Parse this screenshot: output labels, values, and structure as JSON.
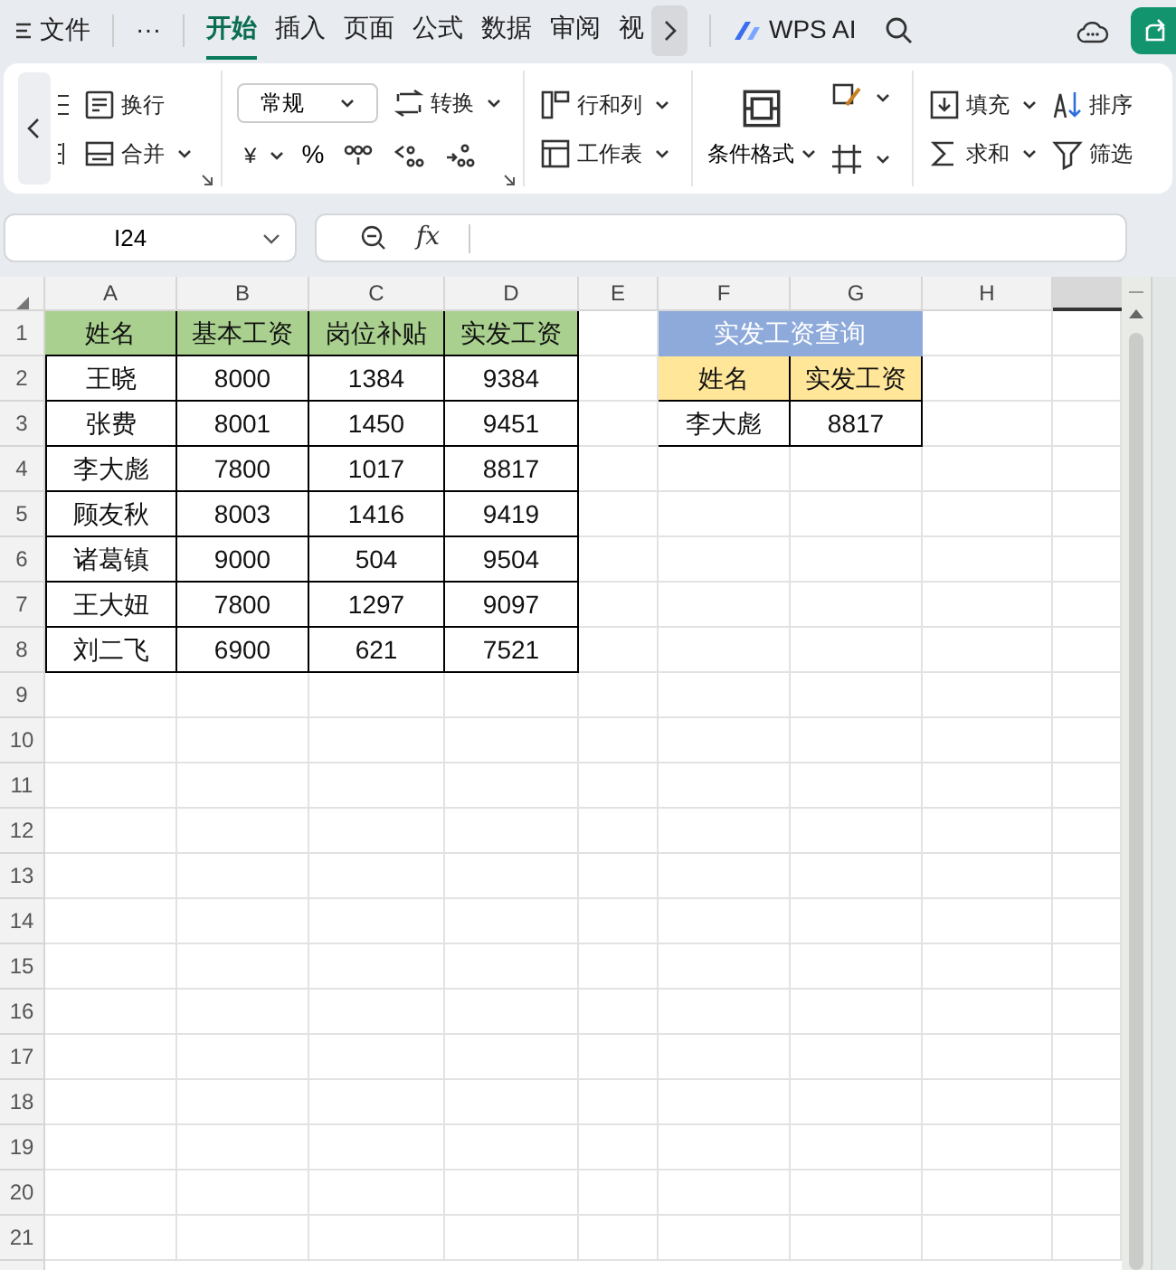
{
  "top_bar": {
    "file_menu": "文件",
    "more": "···",
    "ai_button": "WPS AI"
  },
  "tabs": [
    {
      "label": "开始",
      "selected": true
    },
    {
      "label": "插入",
      "selected": false
    },
    {
      "label": "页面",
      "selected": false
    },
    {
      "label": "公式",
      "selected": false
    },
    {
      "label": "数据",
      "selected": false
    },
    {
      "label": "审阅",
      "selected": false
    },
    {
      "label": "视",
      "selected": false
    }
  ],
  "ribbon": {
    "wrap": "换行",
    "merge": "合并",
    "number_format": "常规",
    "convert": "转换",
    "currency": "¥",
    "percent": "%",
    "rows_cols": "行和列",
    "worksheet": "工作表",
    "conditional_format": "条件格式",
    "fill": "填充",
    "sort": "排序",
    "sum": "求和",
    "filter": "筛选"
  },
  "formula_bar": {
    "name_box": "I24",
    "fx": "fx"
  },
  "columns": [
    "A",
    "B",
    "C",
    "D",
    "E",
    "F",
    "G",
    "H"
  ],
  "row_numbers": [
    "1",
    "2",
    "3",
    "4",
    "5",
    "6",
    "7",
    "8",
    "9",
    "10",
    "11",
    "12",
    "13",
    "14",
    "15",
    "16",
    "17",
    "18",
    "19",
    "20",
    "21"
  ],
  "salary_table": {
    "header": [
      "姓名",
      "基本工资",
      "岗位补贴",
      "实发工资"
    ],
    "rows": [
      [
        "王晓",
        "8000",
        "1384",
        "9384"
      ],
      [
        "张费",
        "8001",
        "1450",
        "9451"
      ],
      [
        "李大彪",
        "7800",
        "1017",
        "8817"
      ],
      [
        "顾友秋",
        "8003",
        "1416",
        "9419"
      ],
      [
        "诸葛镇",
        "9000",
        "504",
        "9504"
      ],
      [
        "王大妞",
        "7800",
        "1297",
        "9097"
      ],
      [
        "刘二飞",
        "6900",
        "621",
        "7521"
      ]
    ]
  },
  "lookup": {
    "title": "实发工资查询",
    "header": [
      "姓名",
      "实发工资"
    ],
    "row": [
      "李大彪",
      "8817"
    ]
  }
}
